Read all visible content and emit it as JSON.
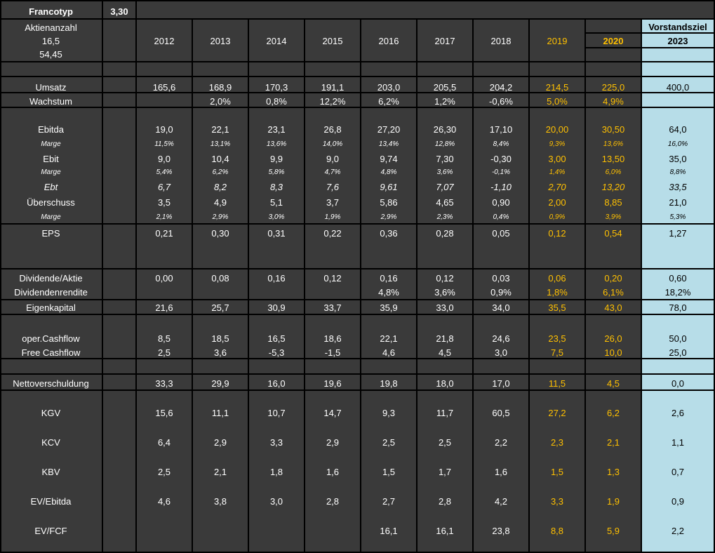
{
  "header": {
    "company": "Francotyp",
    "price": "3,30",
    "shares_label": "Aktienanzahl",
    "shares_value": "16,5",
    "market_cap": "54,45",
    "target_label": "Vorstandsziel"
  },
  "years": [
    "2012",
    "2013",
    "2014",
    "2015",
    "2016",
    "2017",
    "2018",
    "2019",
    "2020",
    "2023"
  ],
  "rows": [
    {
      "label": "Umsatz",
      "values": [
        "165,6",
        "168,9",
        "170,3",
        "191,1",
        "203,0",
        "205,5",
        "204,2",
        "214,5",
        "225,0",
        "400,0"
      ]
    },
    {
      "label": "Wachstum",
      "values": [
        "",
        "2,0%",
        "0,8%",
        "12,2%",
        "6,2%",
        "1,2%",
        "-0,6%",
        "5,0%",
        "4,9%",
        ""
      ]
    },
    {
      "label": "Ebitda",
      "values": [
        "19,0",
        "22,1",
        "23,1",
        "26,8",
        "27,20",
        "26,30",
        "17,10",
        "20,00",
        "30,50",
        "64,0"
      ]
    },
    {
      "label": "Marge",
      "values": [
        "11,5%",
        "13,1%",
        "13,6%",
        "14,0%",
        "13,4%",
        "12,8%",
        "8,4%",
        "9,3%",
        "13,6%",
        "16,0%"
      ]
    },
    {
      "label": "Ebit",
      "values": [
        "9,0",
        "10,4",
        "9,9",
        "9,0",
        "9,74",
        "7,30",
        "-0,30",
        "3,00",
        "13,50",
        "35,0"
      ]
    },
    {
      "label": "Marge",
      "values": [
        "5,4%",
        "6,2%",
        "5,8%",
        "4,7%",
        "4,8%",
        "3,6%",
        "-0,1%",
        "1,4%",
        "6,0%",
        "8,8%"
      ]
    },
    {
      "label": "Ebt",
      "values": [
        "6,7",
        "8,2",
        "8,3",
        "7,6",
        "9,61",
        "7,07",
        "-1,10",
        "2,70",
        "13,20",
        "33,5"
      ]
    },
    {
      "label": "Überschuss",
      "values": [
        "3,5",
        "4,9",
        "5,1",
        "3,7",
        "5,86",
        "4,65",
        "0,90",
        "2,00",
        "8,85",
        "21,0"
      ]
    },
    {
      "label": "Marge",
      "values": [
        "2,1%",
        "2,9%",
        "3,0%",
        "1,9%",
        "2,9%",
        "2,3%",
        "0,4%",
        "0,9%",
        "3,9%",
        "5,3%"
      ]
    },
    {
      "label": "EPS",
      "values": [
        "0,21",
        "0,30",
        "0,31",
        "0,22",
        "0,36",
        "0,28",
        "0,05",
        "0,12",
        "0,54",
        "1,27"
      ]
    },
    {
      "label": "Dividende/Aktie",
      "values": [
        "0,00",
        "0,08",
        "0,16",
        "0,12",
        "0,16",
        "0,12",
        "0,03",
        "0,06",
        "0,20",
        "0,60"
      ]
    },
    {
      "label": "Dividendenrendite",
      "values": [
        "",
        "",
        "",
        "",
        "4,8%",
        "3,6%",
        "0,9%",
        "1,8%",
        "6,1%",
        "18,2%"
      ]
    },
    {
      "label": "Eigenkapital",
      "values": [
        "21,6",
        "25,7",
        "30,9",
        "33,7",
        "35,9",
        "33,0",
        "34,0",
        "35,5",
        "43,0",
        "78,0"
      ]
    },
    {
      "label": "oper.Cashflow",
      "values": [
        "8,5",
        "18,5",
        "16,5",
        "18,6",
        "22,1",
        "21,8",
        "24,6",
        "23,5",
        "26,0",
        "50,0"
      ]
    },
    {
      "label": "Free Cashflow",
      "values": [
        "2,5",
        "3,6",
        "-5,3",
        "-1,5",
        "4,6",
        "4,5",
        "3,0",
        "7,5",
        "10,0",
        "25,0"
      ]
    },
    {
      "label": "Nettoverschuldung",
      "values": [
        "33,3",
        "29,9",
        "16,0",
        "19,6",
        "19,8",
        "18,0",
        "17,0",
        "11,5",
        "4,5",
        "0,0"
      ]
    },
    {
      "label": "KGV",
      "values": [
        "15,6",
        "11,1",
        "10,7",
        "14,7",
        "9,3",
        "11,7",
        "60,5",
        "27,2",
        "6,2",
        "2,6"
      ]
    },
    {
      "label": "KCV",
      "values": [
        "6,4",
        "2,9",
        "3,3",
        "2,9",
        "2,5",
        "2,5",
        "2,2",
        "2,3",
        "2,1",
        "1,1"
      ]
    },
    {
      "label": "KBV",
      "values": [
        "2,5",
        "2,1",
        "1,8",
        "1,6",
        "1,5",
        "1,7",
        "1,6",
        "1,5",
        "1,3",
        "0,7"
      ]
    },
    {
      "label": "EV/Ebitda",
      "values": [
        "4,6",
        "3,8",
        "3,0",
        "2,8",
        "2,7",
        "2,8",
        "4,2",
        "3,3",
        "1,9",
        "0,9"
      ]
    },
    {
      "label": "EV/FCF",
      "values": [
        "",
        "",
        "",
        "",
        "16,1",
        "16,1",
        "23,8",
        "8,8",
        "5,9",
        "2,2"
      ]
    }
  ],
  "colors": {
    "background": "#3a3a3a",
    "forecast": "#ffc000",
    "target_column": "#b7dde8",
    "grid": "#000000",
    "text": "#ffffff"
  }
}
